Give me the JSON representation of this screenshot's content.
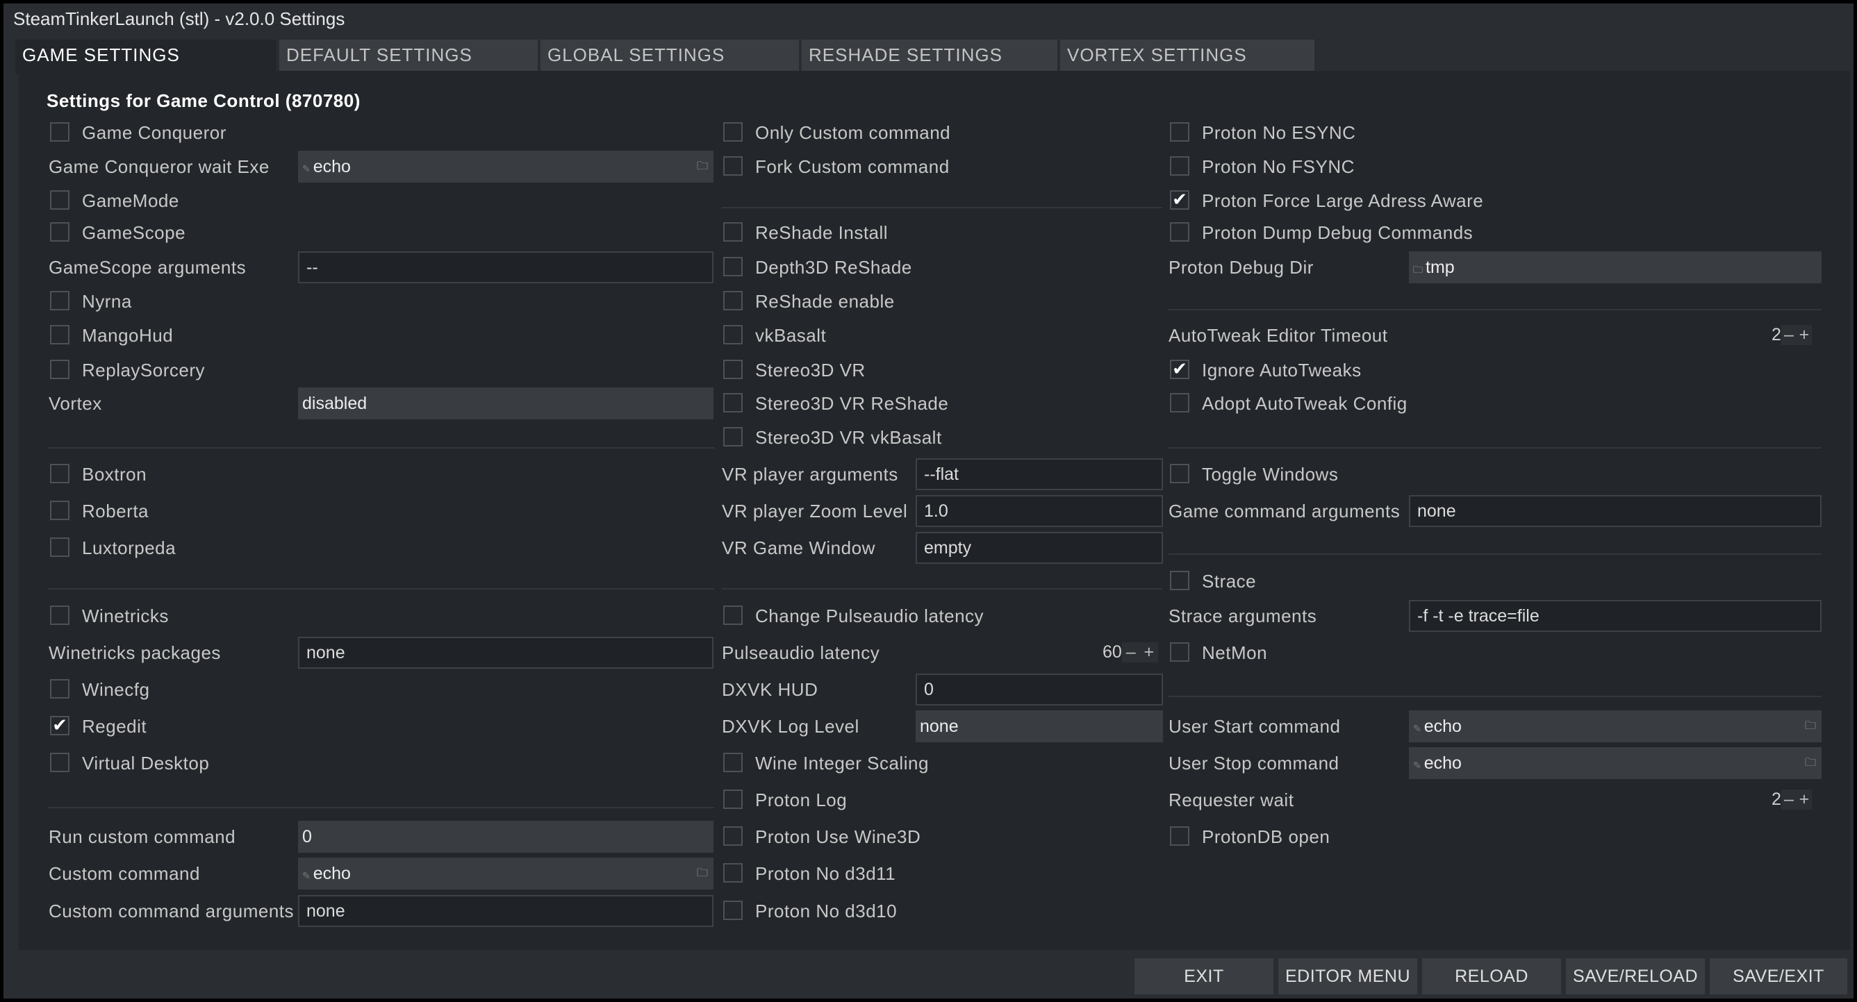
{
  "window": {
    "title": "SteamTinkerLaunch (stl) - v2.0.0 Settings"
  },
  "tabs": [
    {
      "label": "GAME SETTINGS"
    },
    {
      "label": "DEFAULT SETTINGS"
    },
    {
      "label": "GLOBAL SETTINGS"
    },
    {
      "label": "RESHADE SETTINGS"
    },
    {
      "label": "VORTEX SETTINGS"
    }
  ],
  "section_title": "Settings for Game Control (870780)",
  "col1": {
    "game_conqueror": {
      "label": "Game Conqueror",
      "checked": false
    },
    "game_conqueror_wait_exe": {
      "label": "Game Conqueror wait Exe",
      "value": "echo"
    },
    "gamemode": {
      "label": "GameMode",
      "checked": false
    },
    "gamescope": {
      "label": "GameScope",
      "checked": false
    },
    "gamescope_args": {
      "label": "GameScope arguments",
      "value": "--"
    },
    "nyrna": {
      "label": "Nyrna",
      "checked": false
    },
    "mangohud": {
      "label": "MangoHud",
      "checked": false
    },
    "replaysorcery": {
      "label": "ReplaySorcery",
      "checked": false
    },
    "vortex": {
      "label": "Vortex",
      "value": "disabled"
    },
    "boxtron": {
      "label": "Boxtron",
      "checked": false
    },
    "roberta": {
      "label": "Roberta",
      "checked": false
    },
    "luxtorpeda": {
      "label": "Luxtorpeda",
      "checked": false
    },
    "winetricks": {
      "label": "Winetricks",
      "checked": false
    },
    "winetricks_packages": {
      "label": "Winetricks packages",
      "value": "none"
    },
    "winecfg": {
      "label": "Winecfg",
      "checked": false
    },
    "regedit": {
      "label": "Regedit",
      "checked": true
    },
    "virtual_desktop": {
      "label": "Virtual Desktop",
      "checked": false
    },
    "run_custom_command": {
      "label": "Run custom command",
      "value": "0"
    },
    "custom_command": {
      "label": "Custom command",
      "value": "echo"
    },
    "custom_command_args": {
      "label": "Custom command arguments",
      "value": "none"
    }
  },
  "col2": {
    "only_custom": {
      "label": "Only Custom command",
      "checked": false
    },
    "fork_custom": {
      "label": "Fork Custom command",
      "checked": false
    },
    "reshade_install": {
      "label": "ReShade Install",
      "checked": false
    },
    "depth3d": {
      "label": "Depth3D ReShade",
      "checked": false
    },
    "reshade_enable": {
      "label": "ReShade enable",
      "checked": false
    },
    "vkbasalt": {
      "label": "vkBasalt",
      "checked": false
    },
    "stereo3d_vr": {
      "label": "Stereo3D VR",
      "checked": false
    },
    "stereo3d_vr_reshade": {
      "label": "Stereo3D VR ReShade",
      "checked": false
    },
    "stereo3d_vr_vkbasalt": {
      "label": "Stereo3D VR vkBasalt",
      "checked": false
    },
    "vr_player_args": {
      "label": "VR player arguments",
      "value": "--flat"
    },
    "vr_zoom": {
      "label": "VR player Zoom Level",
      "value": "1.0"
    },
    "vr_game_window": {
      "label": "VR Game Window",
      "value": "empty"
    },
    "change_pulse": {
      "label": "Change Pulseaudio latency",
      "checked": false
    },
    "pulse_latency": {
      "label": "Pulseaudio latency",
      "value": "60"
    },
    "dxvk_hud": {
      "label": "DXVK HUD",
      "value": "0"
    },
    "dxvk_log": {
      "label": "DXVK Log Level",
      "value": "none"
    },
    "wine_int_scaling": {
      "label": "Wine Integer Scaling",
      "checked": false
    },
    "proton_log": {
      "label": "Proton Log",
      "checked": false
    },
    "proton_wine3d": {
      "label": "Proton Use Wine3D",
      "checked": false
    },
    "proton_no_d3d11": {
      "label": "Proton No d3d11",
      "checked": false
    },
    "proton_no_d3d10": {
      "label": "Proton No d3d10",
      "checked": false
    }
  },
  "col3": {
    "no_esync": {
      "label": "Proton No ESYNC",
      "checked": false
    },
    "no_fsync": {
      "label": "Proton No FSYNC",
      "checked": false
    },
    "large_address": {
      "label": "Proton Force Large Adress Aware",
      "checked": true
    },
    "dump_debug": {
      "label": "Proton Dump Debug Commands",
      "checked": false
    },
    "debug_dir": {
      "label": "Proton Debug Dir",
      "value": "tmp"
    },
    "autotweak_timeout": {
      "label": "AutoTweak Editor Timeout",
      "value": "2"
    },
    "ignore_autotweaks": {
      "label": "Ignore AutoTweaks",
      "checked": true
    },
    "adopt_autotweak": {
      "label": "Adopt AutoTweak Config",
      "checked": false
    },
    "toggle_windows": {
      "label": "Toggle Windows",
      "checked": false
    },
    "game_cmd_args": {
      "label": "Game command arguments",
      "value": "none"
    },
    "strace": {
      "label": "Strace",
      "checked": false
    },
    "strace_args": {
      "label": "Strace arguments",
      "value": "-f -t -e trace=file"
    },
    "netmon": {
      "label": "NetMon",
      "checked": false
    },
    "user_start": {
      "label": "User Start command",
      "value": "echo"
    },
    "user_stop": {
      "label": "User Stop command",
      "value": "echo"
    },
    "requester_wait": {
      "label": "Requester wait",
      "value": "2"
    },
    "protondb_open": {
      "label": "ProtonDB open",
      "checked": false
    }
  },
  "spin_glyphs": {
    "minus": "–",
    "plus": "+"
  },
  "icons": {
    "check": "✔",
    "folder": "🗀",
    "edit": "✎"
  },
  "buttons": {
    "exit": "EXIT",
    "editor_menu": "EDITOR MENU",
    "reload": "RELOAD",
    "save_reload": "SAVE/RELOAD",
    "save_exit": "SAVE/EXIT"
  }
}
